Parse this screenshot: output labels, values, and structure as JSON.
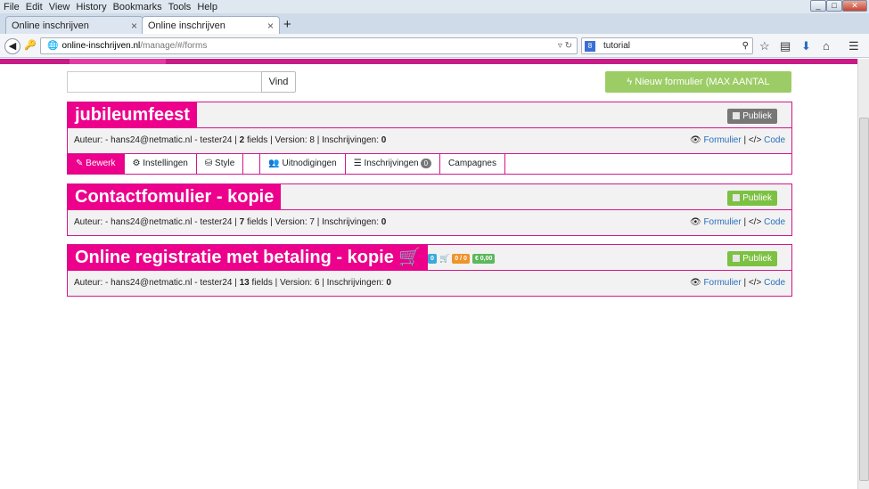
{
  "browser": {
    "menu": [
      "File",
      "Edit",
      "View",
      "History",
      "Bookmarks",
      "Tools",
      "Help"
    ],
    "tabs": [
      {
        "label": "Online inschrijven",
        "close": "×"
      },
      {
        "label": "Online inschrijven",
        "close": "×"
      }
    ],
    "new_tab": "+",
    "url_host": "online-inschrijven.nl",
    "url_path": "/manage/#/forms",
    "search_value": "tutorial"
  },
  "toolbar": {
    "search_placeholder": "",
    "find_label": "Vind",
    "new_form_label": "Nieuw formulier (MAX AANTAL BEREIKT)"
  },
  "forms": [
    {
      "title": "jubileumfeest",
      "status": "Publiek",
      "status_color": "#777777",
      "meta_prefix": "Auteur: - hans24@netmatic.nl - tester24 | ",
      "fields": "2",
      "fields_label": " fields | Version: 8 | Inschrijvingen: ",
      "inschrijvingen": "0",
      "link_formulier": "Formulier",
      "link_code": "Code",
      "tabs": [
        {
          "label": "Bewerk",
          "icon": "pencil-icon"
        },
        {
          "label": "Instellingen",
          "icon": "gears-icon"
        },
        {
          "label": "Style",
          "icon": "style-icon"
        },
        {
          "label": "",
          "icon": ""
        },
        {
          "label": "Uitnodigingen",
          "icon": "users-icon"
        },
        {
          "label": "Inschrijvingen",
          "icon": "list-icon",
          "count": "0"
        },
        {
          "label": "Campagnes",
          "icon": ""
        }
      ]
    },
    {
      "title": "Contactfomulier - kopie",
      "status": "Publiek",
      "status_color": "#7cc142",
      "meta_prefix": "Auteur: - hans24@netmatic.nl - tester24 | ",
      "fields": "7",
      "fields_label": " fields | Version: 7 | Inschrijvingen: ",
      "inschrijvingen": "0",
      "link_formulier": "Formulier",
      "link_code": "Code"
    },
    {
      "title": "Online registratie met betaling - kopie",
      "status": "Publiek",
      "status_color": "#7cc142",
      "badges": [
        "0",
        "0 / 0",
        "€ 0,00"
      ],
      "meta_prefix": "Auteur: - hans24@netmatic.nl - tester24 | ",
      "fields": "13",
      "fields_label": " fields | Version: 6 | Inschrijvingen: ",
      "inschrijvingen": "0",
      "link_formulier": "Formulier",
      "link_code": "Code"
    }
  ]
}
